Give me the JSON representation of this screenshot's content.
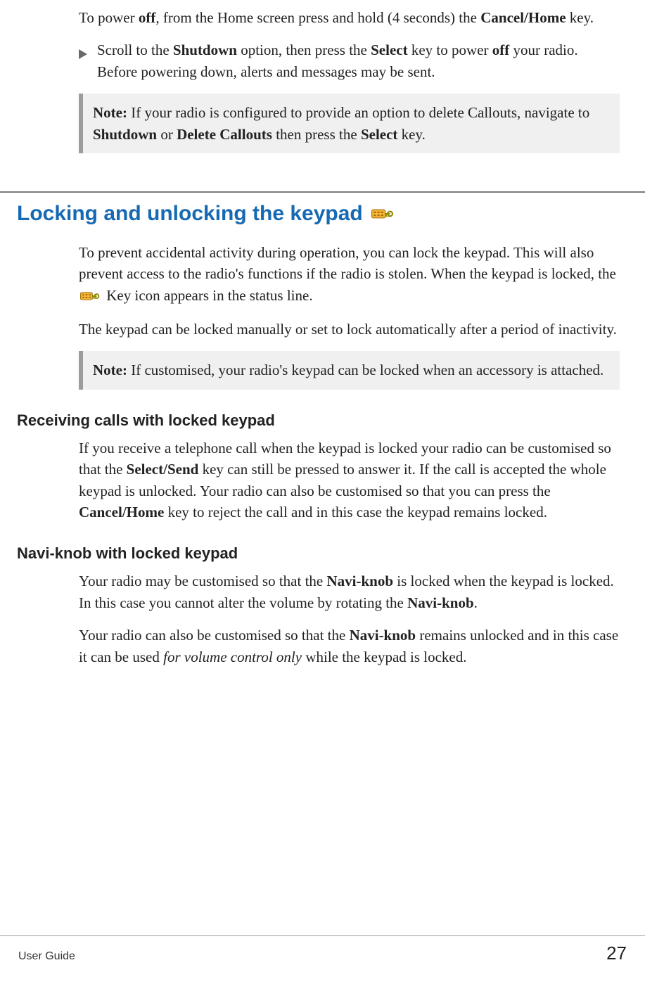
{
  "intro": {
    "p1_a": "To power ",
    "p1_b_off": "off",
    "p1_c": ", from the Home screen press and hold (4 seconds) the ",
    "p1_d_cancel": "Cancel/Home",
    "p1_e": " key."
  },
  "bullet": {
    "a": "Scroll to the ",
    "b_shutdown": "Shutdown",
    "c": " option, then press the ",
    "d_select": "Select",
    "e": " key to power ",
    "f_off": "off",
    "g": " your radio. Before powering down, alerts and messages may be sent."
  },
  "note1": {
    "label": "Note:",
    "a": "  If your radio is configured to provide an option to delete Callouts, navigate to ",
    "b_shutdown": "Shutdown",
    "c": " or ",
    "d_delete": "Delete Callouts",
    "e": " then press the ",
    "f_select": "Select",
    "g": " key."
  },
  "section": {
    "title": "Locking and unlocking the keypad"
  },
  "sec_p1": {
    "a": "To prevent accidental activity during operation, you can lock the keypad. This will also prevent access to the radio's functions if the radio is stolen. When the keypad is locked, the ",
    "b": " Key icon appears in the status line."
  },
  "sec_p2": "The keypad can be locked manually or set to lock automatically after a period of inactivity.",
  "note2": {
    "label": "Note:",
    "a": "  If customised, your radio's keypad can be locked when an accessory is attached."
  },
  "sub1": {
    "heading": "Receiving calls with locked keypad",
    "a": "If you receive a telephone call when the keypad is locked your radio can be customised so that the ",
    "b_ss": "Select/Send",
    "c": " key can still be pressed to answer it. If the call is accepted the whole keypad is unlocked. Your radio can also be customised so that you can press the ",
    "d_ch": "Cancel/Home",
    "e": " key to reject the call and in this case the keypad remains locked."
  },
  "sub2": {
    "heading": "Navi-knob with locked keypad",
    "p1_a": "Your radio may be customised so that the ",
    "p1_b_nk": "Navi-knob",
    "p1_c": " is locked when the keypad is locked. In this case you cannot alter the volume by rotating the ",
    "p1_d_nk": "Navi-knob",
    "p1_e": ".",
    "p2_a": "Your radio can also be customised so that the ",
    "p2_b_nk": "Navi-knob",
    "p2_c": " remains unlocked and in this case it can be used ",
    "p2_d_italic": "for volume control only",
    "p2_e": " while the keypad is locked."
  },
  "footer": {
    "left": "User Guide",
    "right": "27"
  }
}
